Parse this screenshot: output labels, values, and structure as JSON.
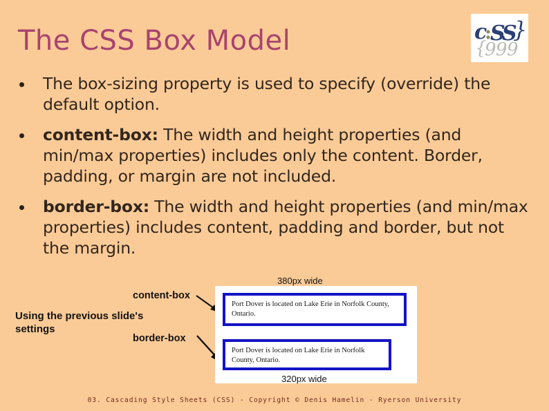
{
  "slide": {
    "title": "The CSS Box Model",
    "background_color": "#fbcb97",
    "title_color": "#a8436e"
  },
  "logo": {
    "name": "css-logo",
    "alt_text": "c:SS}",
    "background_color": "#ffffff",
    "mark_color": "#2a3f73"
  },
  "bullets": [
    {
      "marker": "•",
      "keyword": "",
      "text": "The box-sizing property is used to specify (override) the default option."
    },
    {
      "marker": "•",
      "keyword": "content-box",
      "separator": ":",
      "text": " The width and height properties (and min/max properties) includes only the content. Border, padding, or margin are not included."
    },
    {
      "marker": "•",
      "keyword": "border-box",
      "separator": ":",
      "text": " The width and height properties (and min/max properties) includes content, padding and border, but not the margin."
    }
  ],
  "diagram": {
    "note": "Using the previous slide's settings",
    "callout_content_box": "content-box",
    "callout_border_box": "border-box",
    "size_label_top": "380px wide",
    "size_label_bottom": "320px wide",
    "border_color": "#1414c4",
    "panel_color": "#ffffff",
    "boxes": [
      {
        "name": "content-box-demo",
        "text": "Port Dover is located on Lake Erie in Norfolk County, Ontario.",
        "rendered_width": "380px wide"
      },
      {
        "name": "border-box-demo",
        "text": "Port Dover is located on Lake Erie in Norfolk County, Ontario.",
        "rendered_width": "320px wide"
      }
    ]
  },
  "footer": {
    "text": "03. Cascading Style Sheets (CSS) - Copyright © Denis Hamelin - Ryerson University",
    "color": "#6d2b1c"
  }
}
